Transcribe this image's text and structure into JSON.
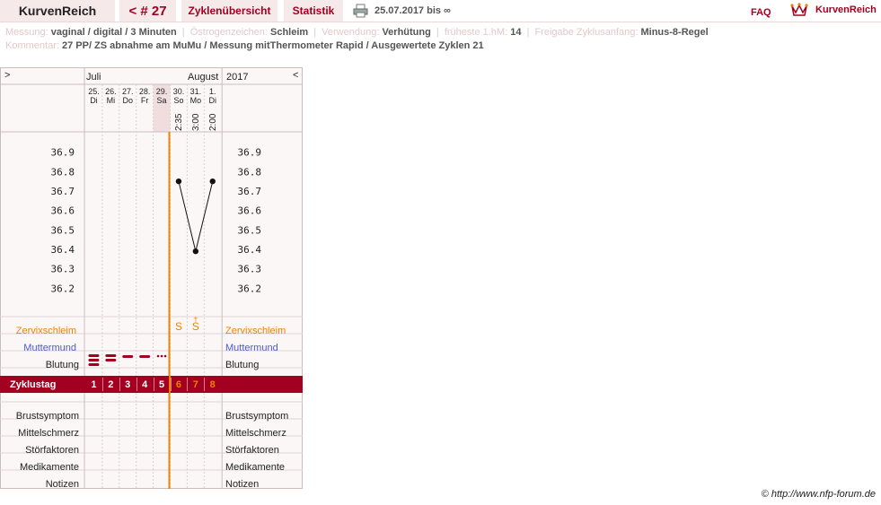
{
  "header": {
    "brand": "KurvenReich",
    "cycle_label": "< # 27",
    "cycles_tab": "Zyklenübersicht",
    "stats_tab": "Statistik",
    "date_range": "25.07.2017 bis ∞",
    "faq": "FAQ",
    "logo_text": "KurvenReich",
    "print_icon": "printer-icon",
    "logo_icon": "crown-icon"
  },
  "info": {
    "messung_label": "Messung:",
    "messung_value": "vaginal / digital / 3 Minuten",
    "oestrogen_label": "Östrogenzeichen:",
    "oestrogen_value": "Schleim",
    "verwendung_label": "Verwendung:",
    "verwendung_value": "Verhütung",
    "hm_label": "früheste 1.hM:",
    "hm_value": "14",
    "freigabe_label": "Freigabe Zyklusanfang:",
    "freigabe_value": "Minus-8-Regel",
    "kommentar_label": "Kommentar:",
    "kommentar_value": "27 PP/  ZS abnahme am MuMu / Messung mitThermometer Rapid / Ausgewertete Zyklen 21"
  },
  "chart_head": {
    "nav_left": ">",
    "nav_right": "<",
    "month1": "Juli",
    "month2": "August",
    "year": "2017",
    "days": [
      {
        "date": "25.",
        "wd": "Di",
        "time": ""
      },
      {
        "date": "26.",
        "wd": "Mi",
        "time": ""
      },
      {
        "date": "27.",
        "wd": "Do",
        "time": ""
      },
      {
        "date": "28.",
        "wd": "Fr",
        "time": ""
      },
      {
        "date": "29.",
        "wd": "Sa",
        "time": ""
      },
      {
        "date": "30.",
        "wd": "So",
        "time": "2:35"
      },
      {
        "date": "31.",
        "wd": "Mo",
        "time": "3:00"
      },
      {
        "date": "1.",
        "wd": "Di",
        "time": "2:00"
      }
    ]
  },
  "chart_data": {
    "type": "line",
    "ylim": [
      36.1,
      37.0
    ],
    "yticks": [
      "36.9",
      "36.8",
      "36.7",
      "36.6",
      "36.5",
      "36.4",
      "36.3",
      "36.2"
    ],
    "x": [
      "25.",
      "26.",
      "27.",
      "28.",
      "29.",
      "30.",
      "31.",
      "1."
    ],
    "series": [
      {
        "values": [
          null,
          null,
          null,
          null,
          null,
          36.75,
          36.39,
          36.75
        ]
      }
    ]
  },
  "rows": {
    "zervix": "Zervixschleim",
    "muttermund": "Muttermund",
    "blutung": "Blutung",
    "zyklustag": "Zyklustag",
    "brust": "Brustsymptom",
    "mittel": "Mittelschmerz",
    "stoer": "Störfaktoren",
    "medi": "Medikamente",
    "notizen": "Notizen"
  },
  "zervix_marks": [
    "",
    "",
    "",
    "",
    "",
    "S",
    "Ṡ",
    ""
  ],
  "zervix_plus": [
    "",
    "",
    "",
    "",
    "",
    "",
    "+",
    ""
  ],
  "bleeding": [
    "heavy",
    "heavy",
    "medium",
    "medium",
    "spotting",
    "",
    "",
    ""
  ],
  "cycle_days": [
    "1",
    "2",
    "3",
    "4",
    "5",
    "6",
    "7",
    "8"
  ],
  "footer": "© http://www.nfp-forum.de",
  "colors": {
    "accent": "#a30021",
    "orange": "#f08000",
    "blue": "#4b5bd0",
    "grid": "#d9cfcf"
  }
}
